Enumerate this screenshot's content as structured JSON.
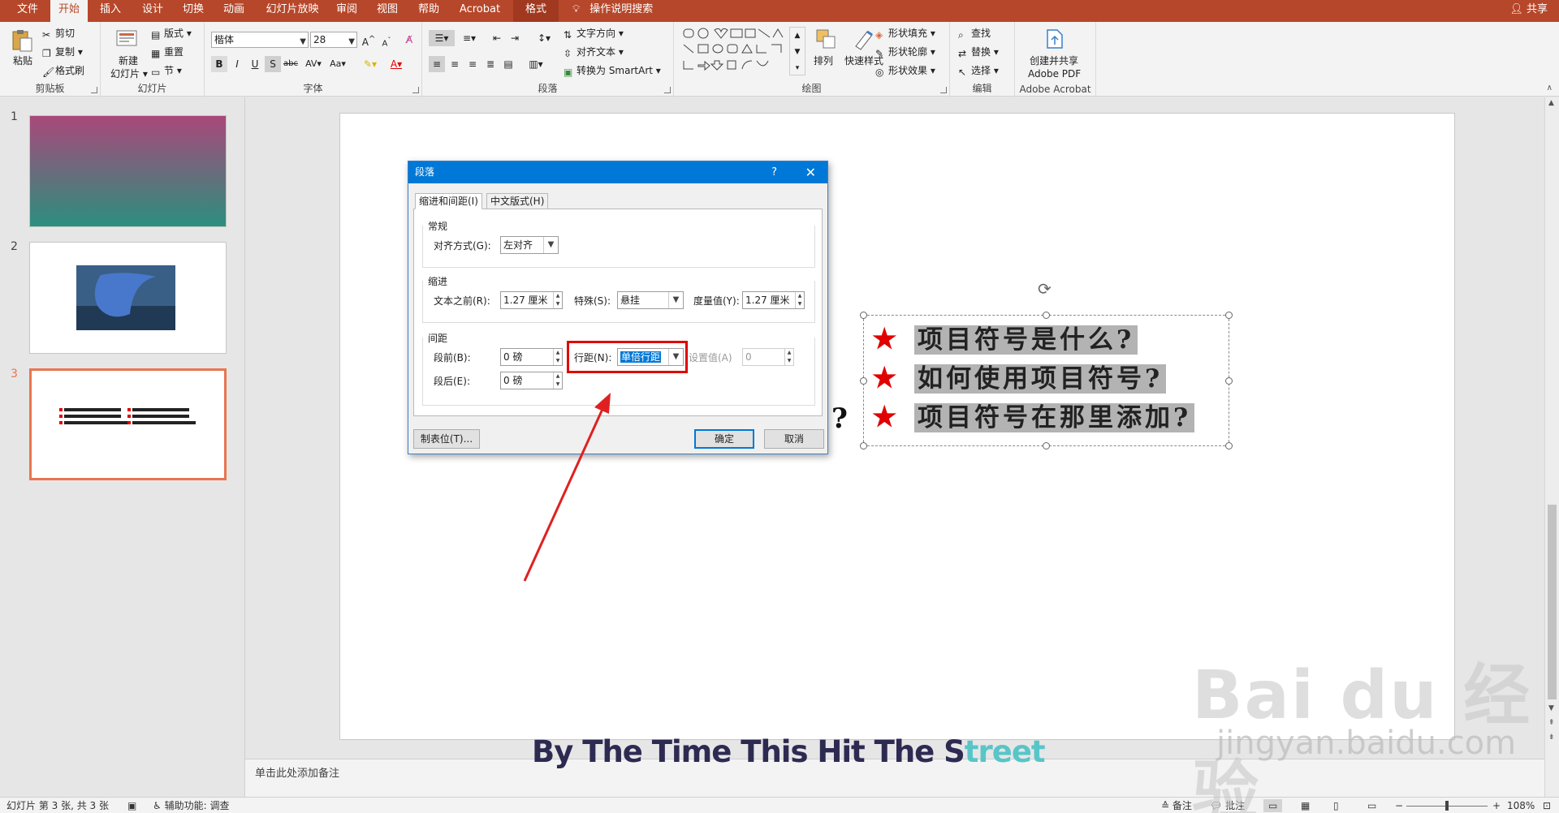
{
  "menu": {
    "tabs": [
      "文件",
      "开始",
      "插入",
      "设计",
      "切换",
      "动画",
      "幻灯片放映",
      "审阅",
      "视图",
      "帮助",
      "Acrobat",
      "格式"
    ],
    "active_tab": "开始",
    "tell_me": "操作说明搜索",
    "share": "共享"
  },
  "ribbon": {
    "clipboard": {
      "label": "剪贴板",
      "paste": "粘贴",
      "cut": "剪切",
      "copy": "复制",
      "format_painter": "格式刷"
    },
    "slides": {
      "label": "幻灯片",
      "new_slide_line1": "新建",
      "new_slide_line2": "幻灯片",
      "layout": "版式",
      "reset": "重置",
      "section": "节"
    },
    "font": {
      "label": "字体",
      "font_name": "楷体",
      "font_size": "28"
    },
    "paragraph": {
      "label": "段落",
      "text_direction": "文字方向",
      "align_text": "对齐文本",
      "smartart": "转换为 SmartArt"
    },
    "drawing": {
      "label": "绘图",
      "arrange": "排列",
      "quick_styles": "快速样式",
      "shape_fill": "形状填充",
      "shape_outline": "形状轮廓",
      "shape_effects": "形状效果"
    },
    "editing": {
      "label": "编辑",
      "find": "查找",
      "replace": "替换",
      "select": "选择"
    },
    "acrobat": {
      "label": "Adobe Acrobat",
      "btn_line1": "创建并共享",
      "btn_line2": "Adobe PDF"
    }
  },
  "thumbnails": [
    {
      "number": "1",
      "selected": false
    },
    {
      "number": "2",
      "selected": false
    },
    {
      "number": "3",
      "selected": true
    }
  ],
  "slide": {
    "bullet_lines": [
      {
        "star": "★",
        "text": "项目符号是什么?"
      },
      {
        "star": "★",
        "text": "如何使用项目符号?"
      },
      {
        "star": "★",
        "text": "项目符号在那里添加?"
      }
    ],
    "stray_char": "?"
  },
  "dialog": {
    "title": "段落",
    "help": "?",
    "close": "✕",
    "tabs": [
      "缩进和间距(I)",
      "中文版式(H)"
    ],
    "general": {
      "section": "常规",
      "alignment_label": "对齐方式(G):",
      "alignment_value": "左对齐"
    },
    "indent": {
      "section": "缩进",
      "before_text_label": "文本之前(R):",
      "before_text_value": "1.27 厘米",
      "special_label": "特殊(S):",
      "special_value": "悬挂",
      "by_label": "度量值(Y):",
      "by_value": "1.27 厘米"
    },
    "spacing": {
      "section": "间距",
      "before_label": "段前(B):",
      "before_value": "0 磅",
      "after_label": "段后(E):",
      "after_value": "0 磅",
      "line_spacing_label": "行距(N):",
      "line_spacing_value": "单倍行距",
      "at_label": "设置值(A)",
      "at_value": "0"
    },
    "tabs_button": "制表位(T)...",
    "ok": "确定",
    "cancel": "取消"
  },
  "notes_placeholder": "单击此处添加备注",
  "status": {
    "slide_info": "幻灯片 第 3 张, 共 3 张",
    "accessibility": "辅助功能: 调查",
    "notes": "备注",
    "comments": "批注",
    "zoom": "108%"
  },
  "overlay": {
    "caption_main": "By The Time This Hit The S",
    "caption_fade": "treet",
    "watermark": "Bai du 经验",
    "watermark_url": "jingyan.baidu.com"
  },
  "colors": {
    "accent": "#b7472a",
    "dialog_title": "#0078d7",
    "highlight_box": "#e00000"
  }
}
